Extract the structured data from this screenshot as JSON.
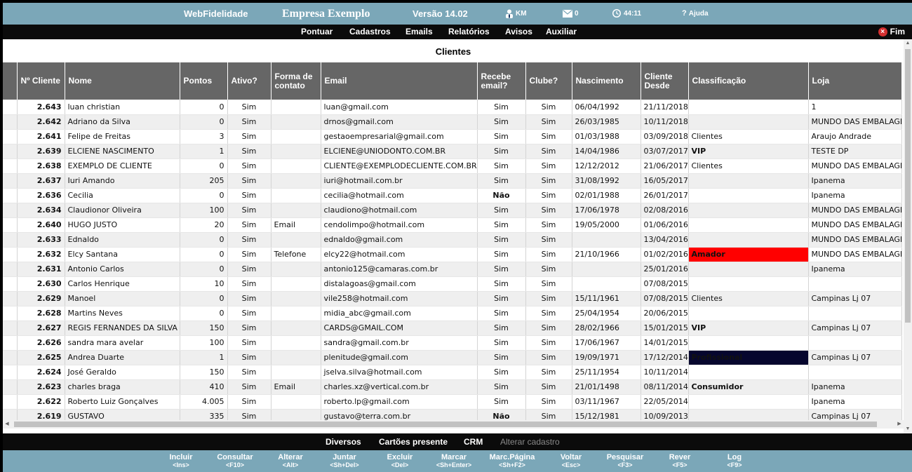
{
  "header": {
    "app_name": "WebFidelidade",
    "company": "Empresa Exemplo",
    "version": "Versão 14.02",
    "user": "KM",
    "messages": "0",
    "timer": "44:11",
    "help": "Ajuda"
  },
  "menu": {
    "items": [
      "Pontuar",
      "Cadastros",
      "Emails",
      "Relatórios",
      "Avisos",
      "Auxiliar"
    ],
    "exit": "Fim"
  },
  "page": {
    "title": "Clientes"
  },
  "table": {
    "headers": {
      "id": "Nº Cliente",
      "name": "Nome",
      "points": "Pontos",
      "active": "Ativo?",
      "contact": "Forma de contato",
      "email": "Email",
      "receive": "Recebe email?",
      "club": "Clube?",
      "birth": "Nascimento",
      "since": "Cliente Desde",
      "class": "Classificação",
      "store": "Loja"
    },
    "rows": [
      {
        "id": "2.643",
        "name": "luan christian",
        "points": "0",
        "active": "Sim",
        "contact": "",
        "email": "luan@gmail.com",
        "receive": "Sim",
        "club": "Sim",
        "birth": "06/04/1992",
        "since": "21/11/2018",
        "class": "",
        "store": "1"
      },
      {
        "id": "2.642",
        "name": "Adriano da Silva",
        "points": "0",
        "active": "Sim",
        "contact": "",
        "email": "drnos@gmail.com",
        "receive": "Sim",
        "club": "Sim",
        "birth": "26/03/1985",
        "since": "10/11/2018",
        "class": "",
        "store": "MUNDO DAS EMBALAGENS"
      },
      {
        "id": "2.641",
        "name": "Felipe de Freitas",
        "points": "3",
        "active": "Sim",
        "contact": "",
        "email": "gestaoempresarial@gmail.com",
        "receive": "Sim",
        "club": "Sim",
        "birth": "01/03/1988",
        "since": "03/09/2018",
        "class": "Clientes",
        "store": "Araujo Andrade"
      },
      {
        "id": "2.639",
        "name": "ELCIENE NASCIMENTO",
        "points": "1",
        "active": "Sim",
        "contact": "",
        "email": "ELCIENE@UNIODONTO.COM.BR",
        "receive": "Sim",
        "club": "Sim",
        "birth": "14/04/1986",
        "since": "03/07/2017",
        "class": "VIP",
        "store": "TESTE DP"
      },
      {
        "id": "2.638",
        "name": "EXEMPLO DE CLIENTE",
        "points": "0",
        "active": "Sim",
        "contact": "",
        "email": "CLIENTE@EXEMPLODECLIENTE.COM.BR",
        "receive": "Sim",
        "club": "Sim",
        "birth": "12/12/2012",
        "since": "21/06/2017",
        "class": "Clientes",
        "store": "MUNDO DAS EMBALAGENS"
      },
      {
        "id": "2.637",
        "name": "Iuri Amando",
        "points": "205",
        "active": "Sim",
        "contact": "",
        "email": "iuri@hotmail.com.br",
        "receive": "Sim",
        "club": "Sim",
        "birth": "31/08/1992",
        "since": "16/05/2017",
        "class": "",
        "store": "Ipanema"
      },
      {
        "id": "2.636",
        "name": "Cecilia",
        "points": "0",
        "active": "Sim",
        "contact": "",
        "email": "cecilia@hotmail.com",
        "receive": "Não",
        "club": "Sim",
        "birth": "02/01/1988",
        "since": "26/01/2017",
        "class": "",
        "store": "Ipanema"
      },
      {
        "id": "2.634",
        "name": "Claudionor Oliveira",
        "points": "100",
        "active": "Sim",
        "contact": "",
        "email": "claudiono@hotmail.com",
        "receive": "Sim",
        "club": "Sim",
        "birth": "17/06/1978",
        "since": "02/08/2016",
        "class": "",
        "store": "MUNDO DAS EMBALAGENS"
      },
      {
        "id": "2.640",
        "name": "HUGO JUSTO",
        "points": "20",
        "active": "Sim",
        "contact": "Email",
        "email": "cendolimpo@hotmail.com",
        "receive": "Sim",
        "club": "Sim",
        "birth": "19/05/2000",
        "since": "01/06/2016",
        "class": "",
        "store": "MUNDO DAS EMBALAGENS"
      },
      {
        "id": "2.633",
        "name": "Ednaldo",
        "points": "0",
        "active": "Sim",
        "contact": "",
        "email": "ednaldo@gmail.com",
        "receive": "Sim",
        "club": "Sim",
        "birth": "",
        "since": "13/04/2016",
        "class": "",
        "store": "MUNDO DAS EMBALAGENS"
      },
      {
        "id": "2.632",
        "name": "Elcy Santana",
        "points": "0",
        "active": "Sim",
        "contact": "Telefone",
        "email": "elcy22@hotmail.com",
        "receive": "Sim",
        "club": "Sim",
        "birth": "21/10/1966",
        "since": "01/02/2016",
        "class": "Amador",
        "store": "MUNDO DAS EMBALAGENS"
      },
      {
        "id": "2.631",
        "name": "Antonio Carlos",
        "points": "0",
        "active": "Sim",
        "contact": "",
        "email": "antonio125@camaras.com.br",
        "receive": "Sim",
        "club": "Sim",
        "birth": "",
        "since": "25/01/2016",
        "class": "",
        "store": "Ipanema"
      },
      {
        "id": "2.630",
        "name": "Carlos Henrique",
        "points": "10",
        "active": "Sim",
        "contact": "",
        "email": "distalagoas@gmail.com",
        "receive": "Sim",
        "club": "Sim",
        "birth": "",
        "since": "07/08/2015",
        "class": "",
        "store": ""
      },
      {
        "id": "2.629",
        "name": "Manoel",
        "points": "0",
        "active": "Sim",
        "contact": "",
        "email": "vile258@hotmail.com",
        "receive": "Sim",
        "club": "Sim",
        "birth": "15/11/1961",
        "since": "07/08/2015",
        "class": "Clientes",
        "store": "Campinas Lj 07"
      },
      {
        "id": "2.628",
        "name": "Martins Neves",
        "points": "0",
        "active": "Sim",
        "contact": "",
        "email": "midia_abc@gmail.com",
        "receive": "Sim",
        "club": "Sim",
        "birth": "25/04/1954",
        "since": "20/06/2015",
        "class": "",
        "store": ""
      },
      {
        "id": "2.627",
        "name": "REGIS FERNANDES DA SILVA",
        "points": "150",
        "active": "Sim",
        "contact": "",
        "email": "CARDS@GMAIL.COM",
        "receive": "Sim",
        "club": "Sim",
        "birth": "28/02/1966",
        "since": "15/01/2015",
        "class": "VIP",
        "store": "Campinas Lj 07"
      },
      {
        "id": "2.626",
        "name": "sandra mara avelar",
        "points": "100",
        "active": "Sim",
        "contact": "",
        "email": "sandra@gmail.com.br",
        "receive": "Sim",
        "club": "Sim",
        "birth": "17/06/1967",
        "since": "14/01/2015",
        "class": "",
        "store": ""
      },
      {
        "id": "2.625",
        "name": "Andrea Duarte",
        "points": "1",
        "active": "Sim",
        "contact": "",
        "email": "plenitude@gmail.com",
        "receive": "Sim",
        "club": "Sim",
        "birth": "19/09/1971",
        "since": "17/12/2014",
        "class": "Profissional",
        "store": "Campinas Lj 07"
      },
      {
        "id": "2.624",
        "name": "José Geraldo",
        "points": "150",
        "active": "Sim",
        "contact": "",
        "email": "jselva.silva@hotmail.com",
        "receive": "Sim",
        "club": "Sim",
        "birth": "25/11/1954",
        "since": "10/11/2014",
        "class": "",
        "store": ""
      },
      {
        "id": "2.623",
        "name": "charles braga",
        "points": "410",
        "active": "Sim",
        "contact": "Email",
        "email": "charles.xz@vertical.com.br",
        "receive": "Sim",
        "club": "Sim",
        "birth": "21/01/1498",
        "since": "08/11/2014",
        "class": "Consumidor",
        "store": "Ipanema"
      },
      {
        "id": "2.622",
        "name": "Roberto Luiz Gonçalves",
        "points": "4.005",
        "active": "Sim",
        "contact": "",
        "email": "roberto.lp@gmail.com",
        "receive": "Sim",
        "club": "Sim",
        "birth": "03/11/1967",
        "since": "22/05/2014",
        "class": "",
        "store": "Ipanema"
      },
      {
        "id": "2.619",
        "name": "GUSTAVO",
        "points": "335",
        "active": "Sim",
        "contact": "",
        "email": "gustavo@terra.com.br",
        "receive": "Não",
        "club": "Sim",
        "birth": "15/12/1981",
        "since": "10/09/2013",
        "class": "",
        "store": "Campinas Lj 07"
      }
    ]
  },
  "subbar": {
    "items": [
      "Diversos",
      "Cartões presente",
      "CRM",
      "Alterar cadastro"
    ]
  },
  "actions": [
    {
      "label": "Incluir",
      "key": "<Ins>"
    },
    {
      "label": "Consultar",
      "key": "<F10>"
    },
    {
      "label": "Alterar",
      "key": "<Alt>"
    },
    {
      "label": "Juntar",
      "key": "<Sh+Del>"
    },
    {
      "label": "Excluir",
      "key": "<Del>"
    },
    {
      "label": "Marcar",
      "key": "<Sh+Enter>"
    },
    {
      "label": "Marc.Página",
      "key": "<Sh+F2>"
    },
    {
      "label": "Voltar",
      "key": "<Esc>"
    },
    {
      "label": "Pesquisar",
      "key": "<F3>"
    },
    {
      "label": "Rever",
      "key": "<F5>"
    },
    {
      "label": "Log",
      "key": "<F9>"
    }
  ],
  "colors": {
    "header_bg": "#7ba7b8",
    "menu_bg": "#0b0b0b",
    "table_header_bg": "#666666",
    "nao": "#e00000",
    "amador_bg": "#ff0000",
    "profissional_bg": "#06062e",
    "class_text": "#ffd400",
    "consumidor": "#1a2db8"
  }
}
